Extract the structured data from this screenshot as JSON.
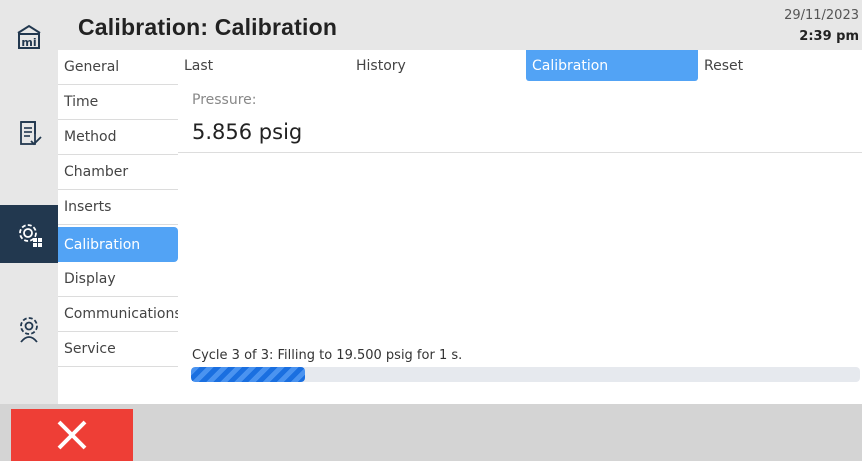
{
  "header": {
    "title": "Calibration: Calibration",
    "date": "29/11/2023",
    "time": "2:39 pm"
  },
  "rail": {
    "icons": [
      "home-icon",
      "method-list-icon",
      "configuration-gear-icon",
      "service-settings-icon"
    ],
    "home_glyph_text": "mi"
  },
  "submenu": {
    "items": [
      {
        "label": "General"
      },
      {
        "label": "Time"
      },
      {
        "label": "Method"
      },
      {
        "label": "Chamber"
      },
      {
        "label": "Inserts"
      },
      {
        "label": "Calibration"
      },
      {
        "label": "Display"
      },
      {
        "label": "Communications"
      },
      {
        "label": "Service"
      }
    ],
    "active": "Calibration"
  },
  "tabs": [
    {
      "label": "Last"
    },
    {
      "label": "History"
    },
    {
      "label": "Calibration"
    },
    {
      "label": "Reset"
    }
  ],
  "active_tab": "Calibration",
  "pressure": {
    "label": "Pressure:",
    "value": "5.856 psig"
  },
  "status": {
    "text": "Cycle 3 of 3: Filling to 19.500 psig for 1 s.",
    "progress_fraction": 0.17
  },
  "bottom": {
    "cancel_icon": "close-icon"
  },
  "colors": {
    "accent": "#52a3f5",
    "rail_active": "#22384f",
    "cancel": "#ee3e36",
    "progress": "#1a6fe0"
  }
}
